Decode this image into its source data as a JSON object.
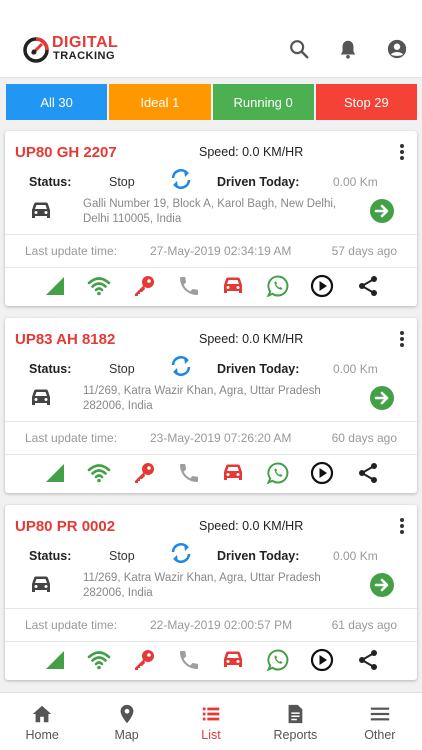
{
  "header": {
    "logo_line1": "DIGITAL",
    "logo_line2": "TRACKING",
    "icons": [
      "search-icon",
      "bell-icon",
      "account-icon"
    ]
  },
  "tabs": [
    {
      "label": "All 30",
      "color": "#2196f3"
    },
    {
      "label": "Ideal 1",
      "color": "#ff9800"
    },
    {
      "label": "Running 0",
      "color": "#4caf50"
    },
    {
      "label": "Stop 29",
      "color": "#f44336"
    }
  ],
  "labels": {
    "status": "Status:",
    "driven": "Driven Today:",
    "last_update": "Last update time:"
  },
  "vehicles": [
    {
      "plate": "UP80 GH 2207",
      "speed": "Speed: 0.0 KM/HR",
      "status": "Stop",
      "driven": "0.00 Km",
      "address": "Galli Number 19, Block A, Karol Bagh, New Delhi, Delhi 110005, India",
      "updated": "27-May-2019 02:34:19 AM",
      "ago": "57 days ago"
    },
    {
      "plate": "UP83 AH 8182",
      "speed": "Speed: 0.0 KM/HR",
      "status": "Stop",
      "driven": "0.00 Km",
      "address": "11/269, Katra Wazir Khan, Agra, Uttar Pradesh 282006, India",
      "updated": "23-May-2019 07:26:20 AM",
      "ago": "60 days ago"
    },
    {
      "plate": "UP80 PR 0002",
      "speed": "Speed: 0.0 KM/HR",
      "status": "Stop",
      "driven": "0.00 Km",
      "address": "11/269, Katra Wazir Khan, Agra, Uttar Pradesh 282006, India",
      "updated": "22-May-2019 02:00:57 PM",
      "ago": "61 days ago"
    }
  ],
  "action_icons": [
    "signal-icon",
    "wifi-icon",
    "key-icon",
    "phone-icon",
    "car-icon",
    "whatsapp-icon",
    "play-icon",
    "share-icon"
  ],
  "colors": {
    "accent": "#e53935",
    "green": "#43a047",
    "grey": "#9e9e9e",
    "blue": "#1e88e5"
  },
  "nav": [
    {
      "label": "Home",
      "icon": "home-icon"
    },
    {
      "label": "Map",
      "icon": "map-pin-icon"
    },
    {
      "label": "List",
      "icon": "list-icon",
      "active": true
    },
    {
      "label": "Reports",
      "icon": "report-icon"
    },
    {
      "label": "Other",
      "icon": "menu-icon"
    }
  ]
}
